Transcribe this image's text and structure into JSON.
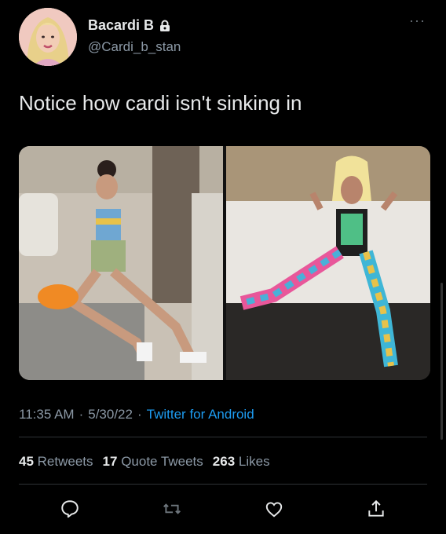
{
  "user": {
    "display_name": "Bacardi B",
    "handle": "@Cardi_b_stan"
  },
  "tweet": {
    "text": "Notice how cardi isn't sinking in"
  },
  "meta": {
    "time": "11:35 AM",
    "date": "5/30/22",
    "separator": "·",
    "source": "Twitter for Android"
  },
  "stats": {
    "retweets_count": "45",
    "retweets_label": "Retweets",
    "quotes_count": "17",
    "quotes_label": "Quote Tweets",
    "likes_count": "263",
    "likes_label": "Likes"
  },
  "icons": {
    "lock": "lock-icon",
    "more": "more-icon",
    "reply": "reply-icon",
    "retweet": "retweet-icon",
    "like": "heart-icon",
    "share": "share-icon"
  },
  "colors": {
    "background": "#000000",
    "text": "#e7e9ea",
    "muted": "#8b98a5",
    "link": "#1d9bf0"
  }
}
